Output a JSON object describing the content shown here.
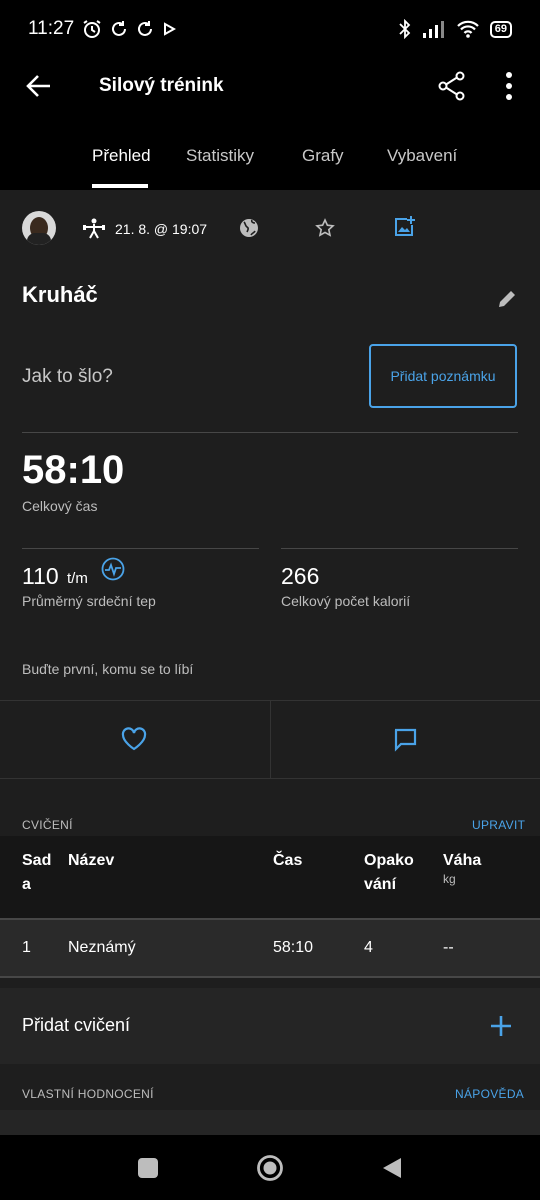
{
  "status": {
    "time": "11:27",
    "battery": "69"
  },
  "app_bar": {
    "title": "Silový trénink"
  },
  "tabs": [
    {
      "label": "Přehled"
    },
    {
      "label": "Statistiky"
    },
    {
      "label": "Grafy"
    },
    {
      "label": "Vybavení"
    }
  ],
  "activity": {
    "date": "21. 8. @ 19:07",
    "name": "Kruháč",
    "note_prompt": "Jak to šlo?",
    "add_note_label": "Přidat poznámku"
  },
  "stats": {
    "total_time": "58:10",
    "total_time_label": "Celkový čas",
    "avg_hr": "110",
    "avg_hr_unit": "t/m",
    "avg_hr_label": "Průměrný srdeční tep",
    "calories": "266",
    "calories_label": "Celkový počet kalorií"
  },
  "social": {
    "like_prompt": "Buďte první, komu se to líbí"
  },
  "exercises": {
    "section_label": "CVIČENÍ",
    "edit_label": "UPRAVIT",
    "columns": {
      "set_line1": "Sad",
      "set_line2": "a",
      "name": "Název",
      "time": "Čas",
      "reps_line1": "Opako",
      "reps_line2": "vání",
      "weight": "Váha",
      "weight_unit": "kg"
    },
    "rows": [
      {
        "set": "1",
        "name": "Neznámý",
        "time": "58:10",
        "reps": "4",
        "weight": "--"
      }
    ],
    "add_label": "Přidat cvičení"
  },
  "self_eval": {
    "section_label": "VLASTNÍ HODNOCENÍ",
    "help_label": "NÁPOVĚDA"
  },
  "colors": {
    "accent": "#4aa3e8",
    "background": "#1e1e1e",
    "bar": "#000000"
  }
}
